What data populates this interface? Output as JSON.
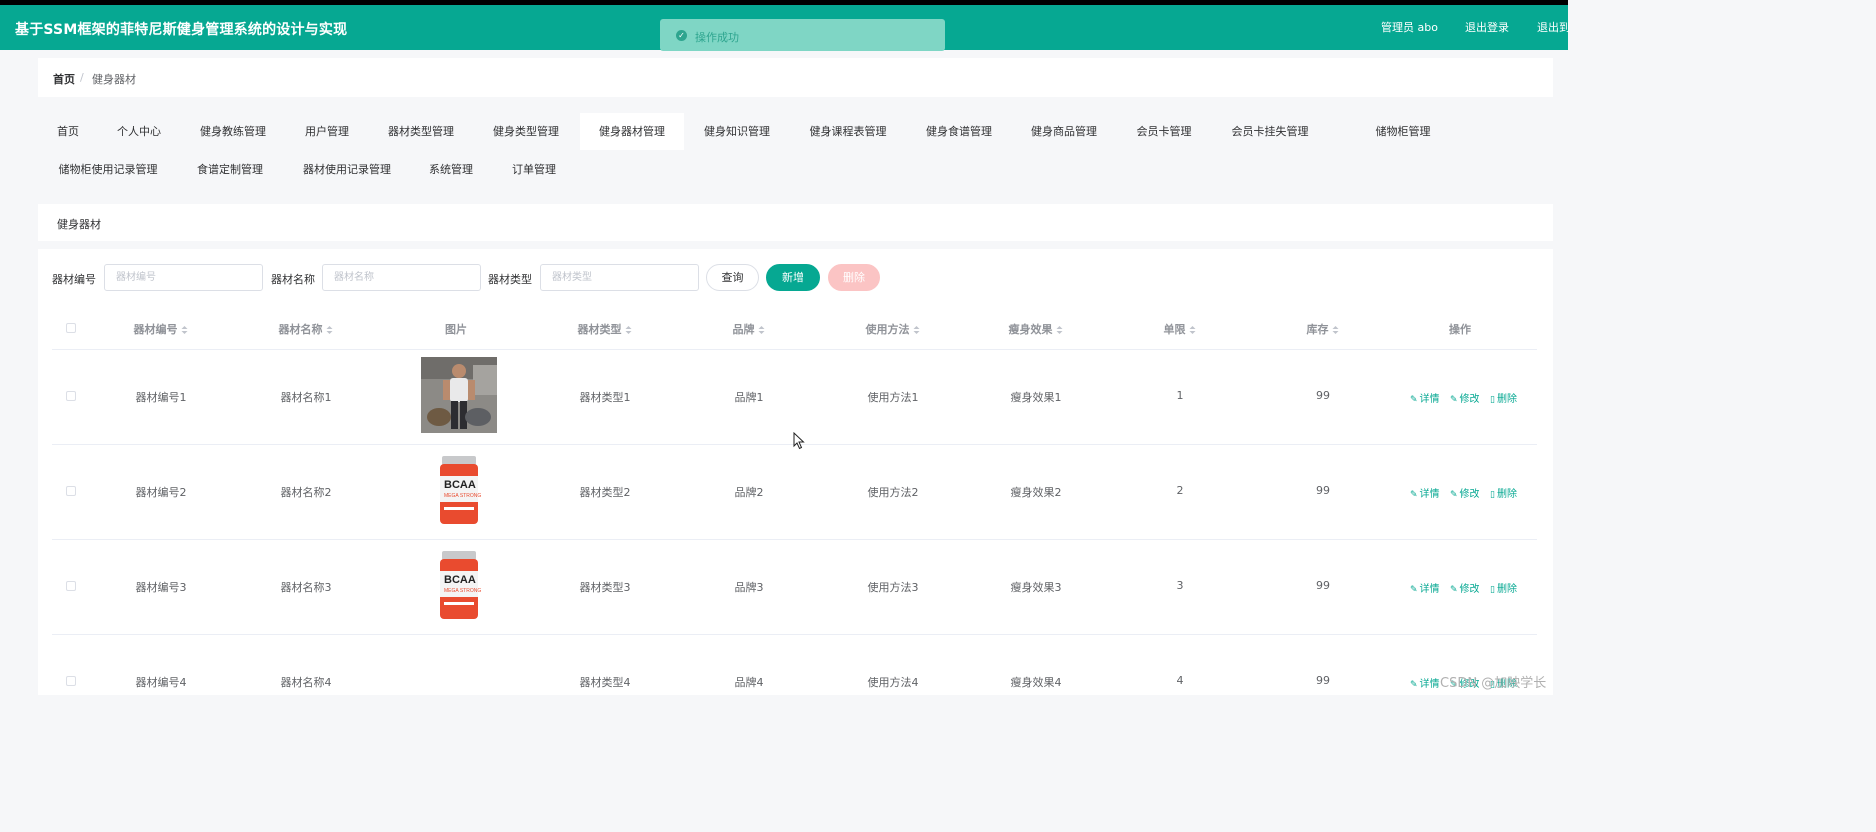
{
  "header": {
    "title": "基于SSM框架的菲特尼斯健身管理系统的设计与实现",
    "admin": "管理员 abo",
    "logout": "退出登录",
    "logout2": "退出到"
  },
  "toast": {
    "message": "操作成功"
  },
  "breadcrumb": {
    "home": "首页",
    "separator": "/",
    "current": "健身器材"
  },
  "nav": {
    "items": [
      {
        "label": "首页"
      },
      {
        "label": "个人中心"
      },
      {
        "label": "健身教练管理"
      },
      {
        "label": "用户管理"
      },
      {
        "label": "器材类型管理"
      },
      {
        "label": "健身类型管理"
      },
      {
        "label": "健身器材管理",
        "active": true
      },
      {
        "label": "健身知识管理"
      },
      {
        "label": "健身课程表管理"
      },
      {
        "label": "健身食谱管理"
      },
      {
        "label": "健身商品管理"
      },
      {
        "label": "会员卡管理"
      },
      {
        "label": "会员卡挂失管理"
      },
      {
        "label": "储物柜管理"
      },
      {
        "label": "储物柜使用记录管理"
      },
      {
        "label": "食谱定制管理"
      },
      {
        "label": "器材使用记录管理"
      },
      {
        "label": "系统管理"
      },
      {
        "label": "订单管理"
      }
    ]
  },
  "section": {
    "title": "健身器材"
  },
  "filters": {
    "code_label": "器材编号",
    "code_placeholder": "器材编号",
    "name_label": "器材名称",
    "name_placeholder": "器材名称",
    "type_label": "器材类型",
    "type_placeholder": "器材类型",
    "query": "查询",
    "add": "新增",
    "delete": "删除"
  },
  "table": {
    "columns": [
      "器材编号",
      "器材名称",
      "图片",
      "器材类型",
      "品牌",
      "使用方法",
      "瘦身效果",
      "单限",
      "库存",
      "操作"
    ],
    "actions": {
      "detail": "详情",
      "edit": "修改",
      "delete": "删除"
    },
    "rows": [
      {
        "code": "器材编号1",
        "name": "器材名称1",
        "image": "man-with-bags-photo",
        "type": "器材类型1",
        "brand": "品牌1",
        "usage": "使用方法1",
        "effect": "瘦身效果1",
        "limit": "1",
        "stock": "99"
      },
      {
        "code": "器材编号2",
        "name": "器材名称2",
        "image": "bcaa-supplement-tub",
        "type": "器材类型2",
        "brand": "品牌2",
        "usage": "使用方法2",
        "effect": "瘦身效果2",
        "limit": "2",
        "stock": "99"
      },
      {
        "code": "器材编号3",
        "name": "器材名称3",
        "image": "bcaa-supplement-tub",
        "type": "器材类型3",
        "brand": "品牌3",
        "usage": "使用方法3",
        "effect": "瘦身效果3",
        "limit": "3",
        "stock": "99"
      },
      {
        "code": "器材编号4",
        "name": "器材名称4",
        "image": "",
        "type": "器材类型4",
        "brand": "品牌4",
        "usage": "使用方法4",
        "effect": "瘦身效果4",
        "limit": "4",
        "stock": "99"
      }
    ]
  },
  "watermark": "CSDN @加映学长",
  "colors": {
    "primary": "#06a892",
    "danger_disabled": "#fbc4c4",
    "toast_bg": "#7fd6c5"
  }
}
